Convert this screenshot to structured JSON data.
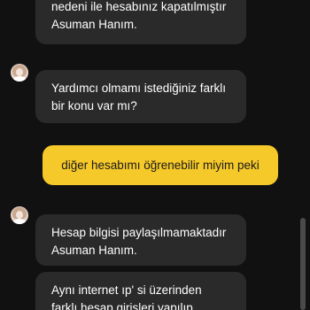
{
  "messages": [
    {
      "sender": "agent",
      "text": "nedeni ile hesabınız kapatılmıştır\nAsuman Hanım."
    },
    {
      "sender": "agent",
      "text": "Yardımcı olmamı istediğiniz farklı\nbir konu var mı?"
    },
    {
      "sender": "user",
      "text": "diğer hesabımı öğrenebilir miyim peki"
    },
    {
      "sender": "agent",
      "text": "Hesap bilgisi paylaşılmamaktadır\nAsuman Hanım."
    },
    {
      "sender": "agent",
      "text": "Aynı internet ıp' si üzerinden\nfarklı hesap girişleri yapılıp"
    }
  ],
  "colors": {
    "background": "#111111",
    "agent_bubble": "#2a2a2a",
    "user_bubble": "#f6c92a"
  },
  "icons": {
    "agent_avatar": "agent-avatar-icon"
  }
}
